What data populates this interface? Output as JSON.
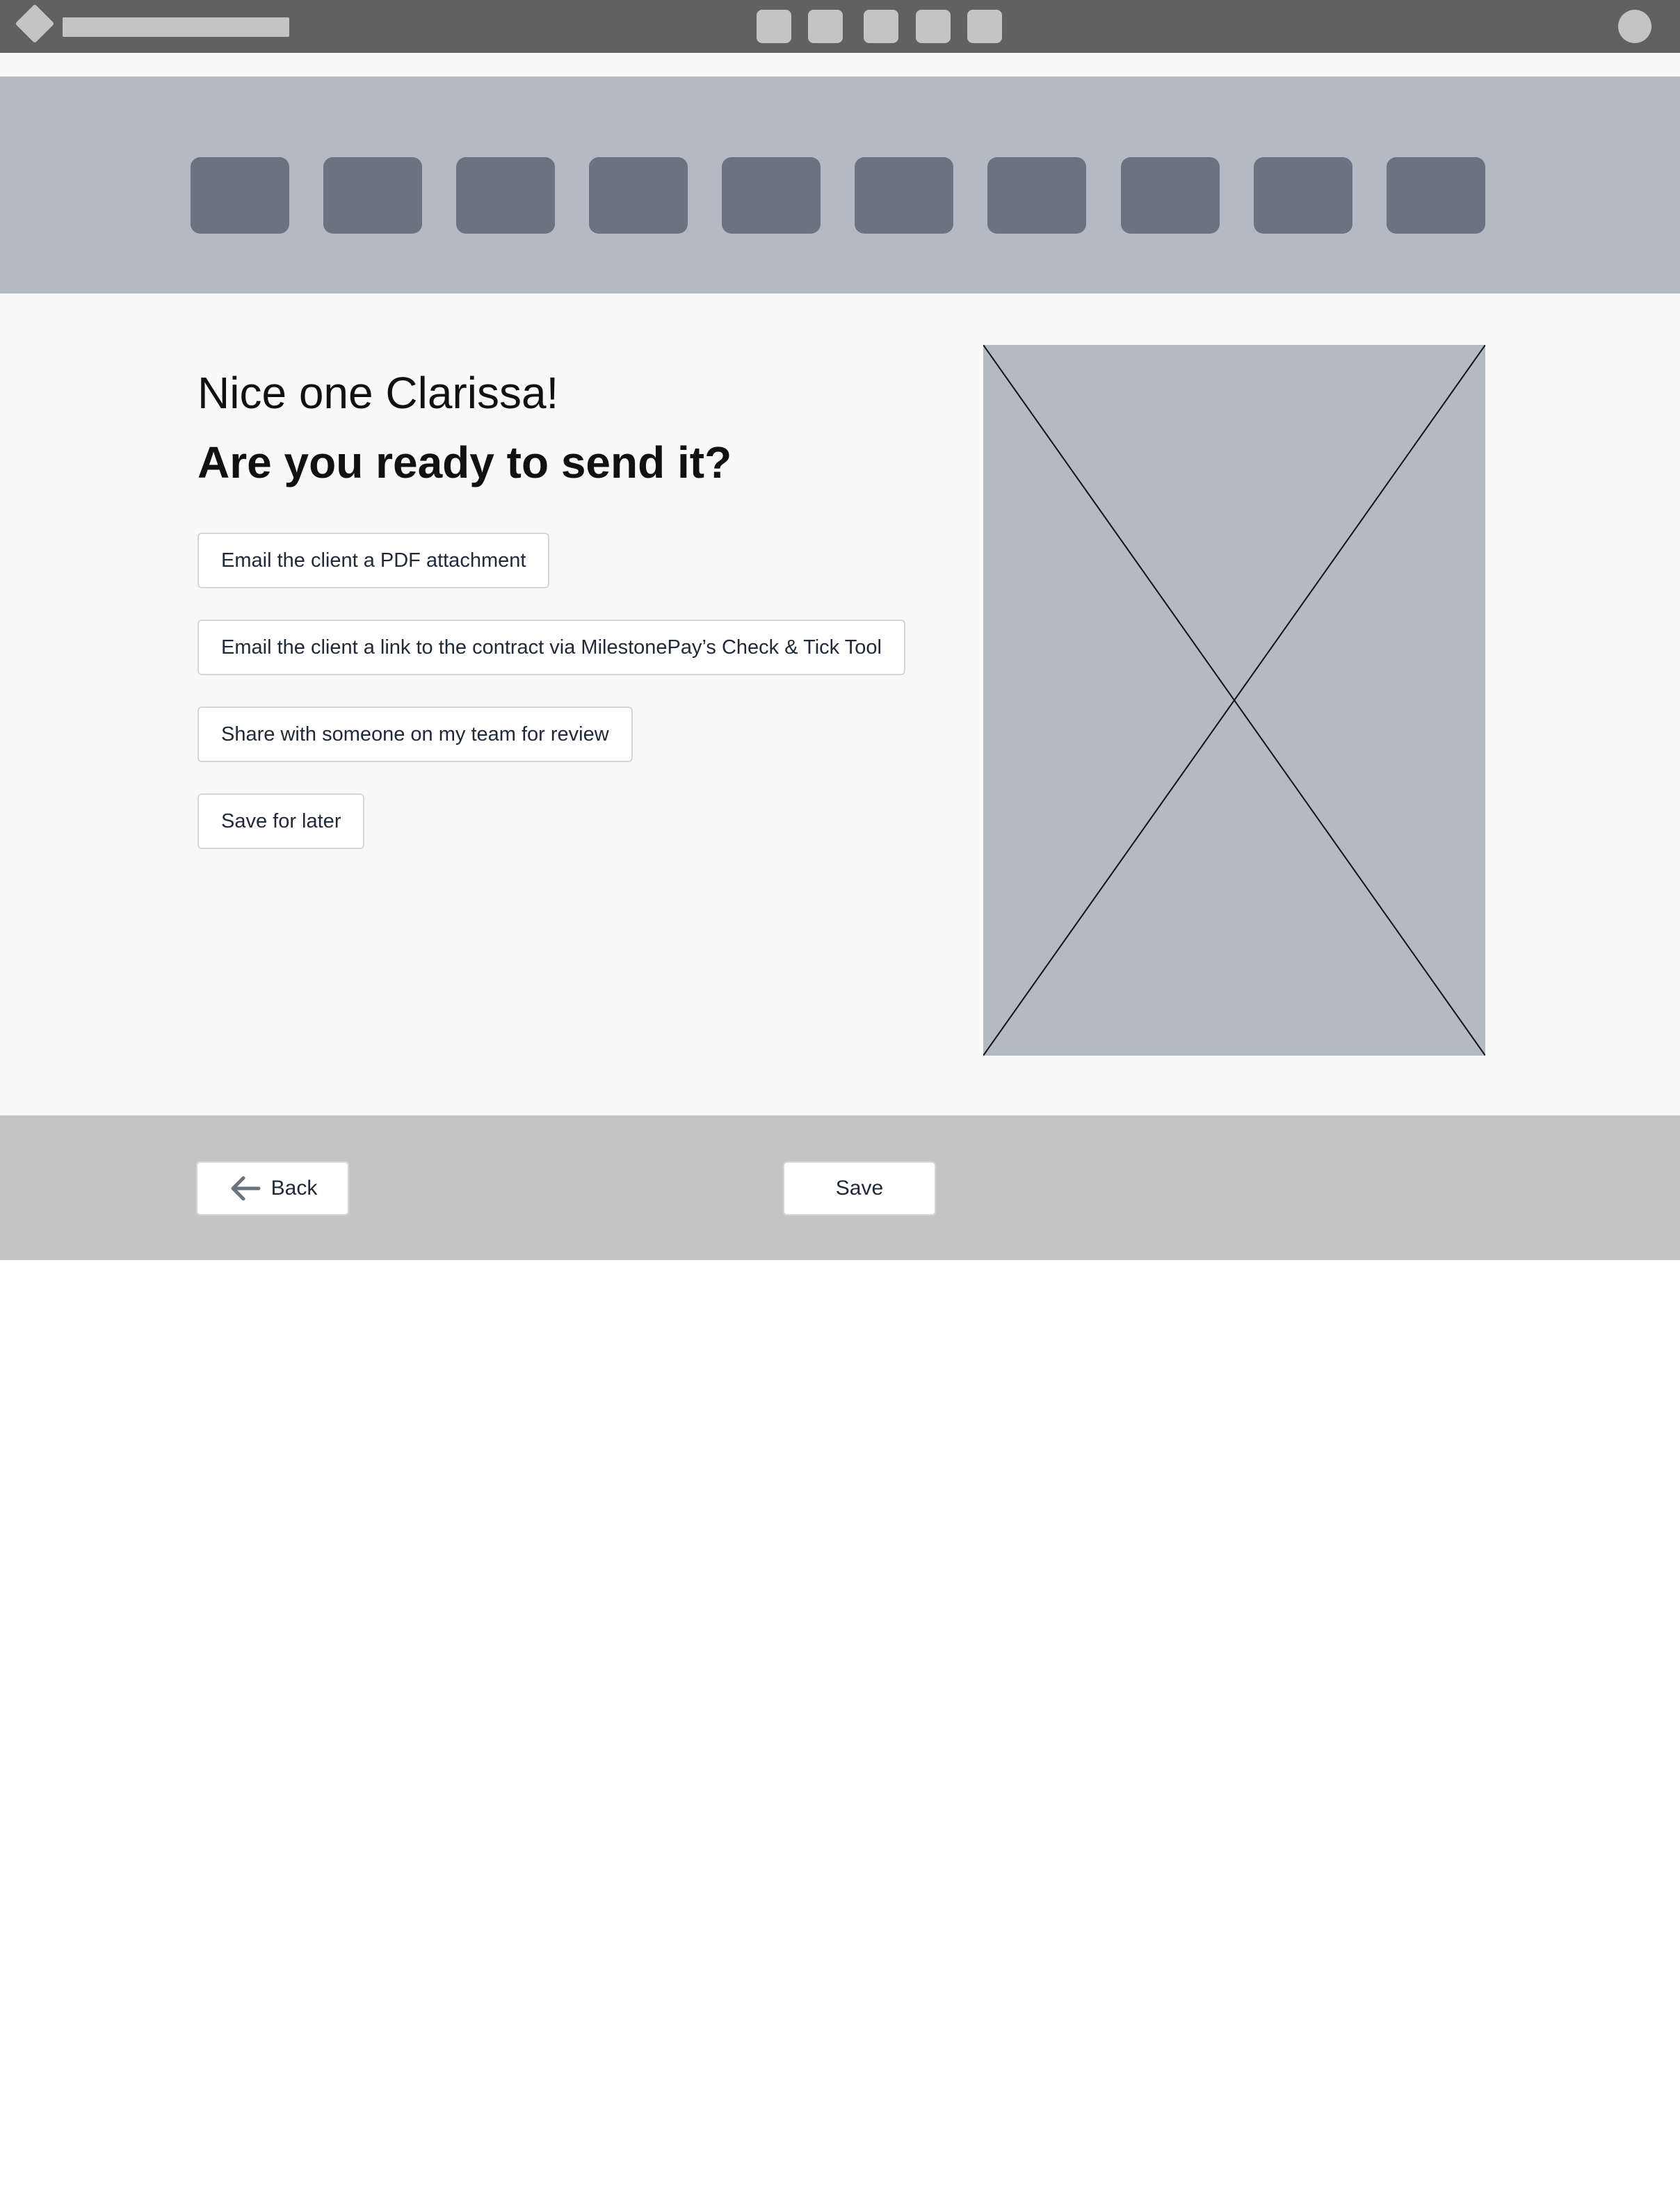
{
  "colors": {
    "topbar": "#616161",
    "placeholder_gray": "#c4c4c4",
    "steps_band": "#b3bac3",
    "step_tile": "#6b7280",
    "main_bg": "#f9f9f9",
    "footer": "#c4c4c4"
  },
  "header": {
    "logo_icon": "diamond-logo",
    "avatar_icon": "user-avatar"
  },
  "main": {
    "greeting": "Nice one Clarissa!",
    "question": "Are you ready to send it?",
    "options": [
      "Email the client a PDF attachment",
      "Email the client a link to the contract via MilestonePay’s Check & Tick Tool",
      "Share with someone on my team for review",
      "Save for later"
    ],
    "preview_icon": "image-placeholder"
  },
  "footer": {
    "back_label": "Back",
    "back_icon": "arrow-left-icon",
    "save_label": "Save"
  }
}
